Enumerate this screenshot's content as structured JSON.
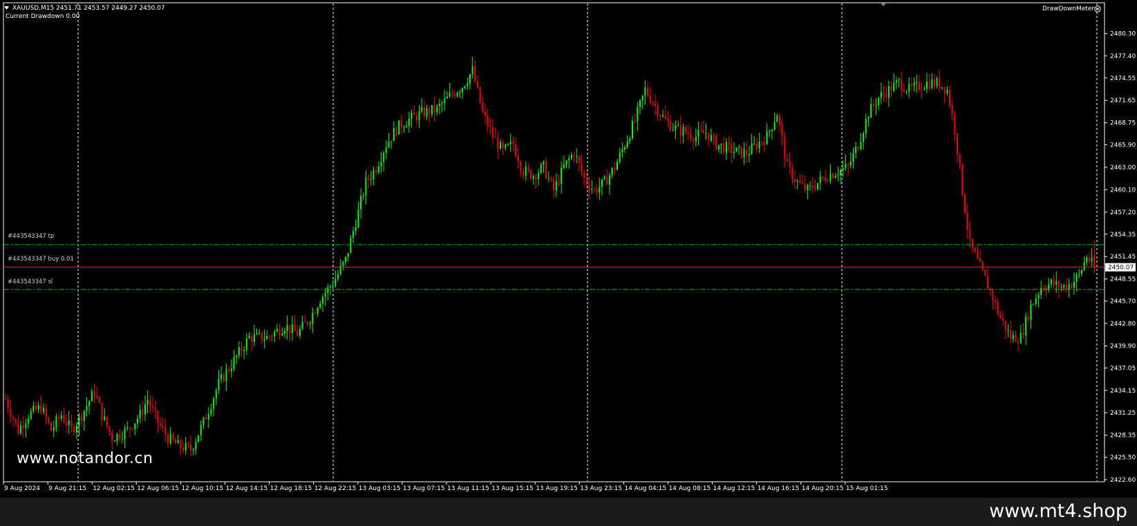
{
  "header": {
    "symbol_line": "XAUUSD,M15  2451.71 2453.57 2449.27 2450.07",
    "drawdown_line": "Current Drawdown 0.00",
    "indicator_name": "DrawDownMeter"
  },
  "orders": {
    "tp_label": "#443543347 tp",
    "buy_label": "#443543347 buy 0.01",
    "sl_label": "#443543347 sl"
  },
  "watermarks": {
    "left": "www.notandor.cn",
    "right": "www.mt4.shop"
  },
  "icons": {
    "header_dropdown": "triangle-down-icon",
    "indicator_close": "close-circle-icon",
    "scroll_marker": "triangle-down-icon"
  },
  "colors": {
    "background": "#000000",
    "bull": "#00ff00",
    "bear": "#ff0000",
    "grid": "#ffffff",
    "tp_sl_line": "#00c000",
    "price_line": "#ff2020",
    "text": "#ffffff"
  },
  "chart_data": {
    "type": "candlestick",
    "symbol": "XAUUSD",
    "timeframe": "M15",
    "ohlc_last": {
      "open": 2451.71,
      "high": 2453.57,
      "low": 2449.27,
      "close": 2450.07
    },
    "ylim": [
      2422.6,
      2481.5
    ],
    "y_ticks": [
      "2480.30",
      "2477.40",
      "2474.55",
      "2471.65",
      "2468.75",
      "2465.90",
      "2463.00",
      "2460.10",
      "2457.20",
      "2454.35",
      "2451.45",
      "2448.55",
      "2445.70",
      "2442.80",
      "2439.90",
      "2437.05",
      "2434.15",
      "2431.25",
      "2428.35",
      "2425.50",
      "2422.60"
    ],
    "current_price": "2450.07",
    "x_ticks": [
      "9 Aug 2024",
      "9 Aug 21:15",
      "12 Aug 02:15",
      "12 Aug 06:15",
      "12 Aug 10:15",
      "12 Aug 14:15",
      "12 Aug 18:15",
      "12 Aug 22:15",
      "13 Aug 03:15",
      "13 Aug 07:15",
      "13 Aug 11:15",
      "13 Aug 15:15",
      "13 Aug 19:15",
      "13 Aug 23:15",
      "14 Aug 04:15",
      "14 Aug 08:15",
      "14 Aug 12:15",
      "14 Aug 16:15",
      "14 Aug 20:15",
      "15 Aug 01:15"
    ],
    "order_levels": {
      "tp": 2453.0,
      "entry": 2450.1,
      "sl": 2447.2
    },
    "grid": "vertical-dashed",
    "price_path": [
      [
        0,
        2433
      ],
      [
        5,
        2429
      ],
      [
        9,
        2431
      ],
      [
        14,
        2432
      ],
      [
        18,
        2429
      ],
      [
        22,
        2431
      ],
      [
        26,
        2429
      ],
      [
        30,
        2431
      ],
      [
        35,
        2434
      ],
      [
        38,
        2431
      ],
      [
        42,
        2428
      ],
      [
        48,
        2429
      ],
      [
        53,
        2431
      ],
      [
        56,
        2433
      ],
      [
        60,
        2430
      ],
      [
        64,
        2428
      ],
      [
        68,
        2427
      ],
      [
        73,
        2426.5
      ],
      [
        78,
        2430
      ],
      [
        84,
        2435
      ],
      [
        90,
        2438
      ],
      [
        96,
        2441
      ],
      [
        103,
        2441
      ],
      [
        110,
        2442.5
      ],
      [
        115,
        2441.5
      ],
      [
        120,
        2443.5
      ],
      [
        124,
        2446
      ],
      [
        129,
        2448
      ],
      [
        134,
        2451
      ],
      [
        138,
        2456
      ],
      [
        142,
        2461
      ],
      [
        146,
        2463
      ],
      [
        150,
        2466
      ],
      [
        154,
        2468
      ],
      [
        158,
        2469
      ],
      [
        164,
        2470
      ],
      [
        170,
        2470.5
      ],
      [
        176,
        2472.5
      ],
      [
        180,
        2473.5
      ],
      [
        184,
        2475.5
      ],
      [
        188,
        2470
      ],
      [
        192,
        2467
      ],
      [
        196,
        2465
      ],
      [
        200,
        2466
      ],
      [
        204,
        2462.5
      ],
      [
        208,
        2462
      ],
      [
        212,
        2463
      ],
      [
        216,
        2460
      ],
      [
        220,
        2463
      ],
      [
        224,
        2465
      ],
      [
        228,
        2461.5
      ],
      [
        232,
        2460
      ],
      [
        236,
        2461
      ],
      [
        240,
        2463
      ],
      [
        244,
        2466
      ],
      [
        248,
        2469
      ],
      [
        252,
        2473
      ],
      [
        256,
        2471
      ],
      [
        260,
        2469
      ],
      [
        264,
        2468
      ],
      [
        268,
        2467.5
      ],
      [
        272,
        2467
      ],
      [
        276,
        2467.5
      ],
      [
        280,
        2466
      ],
      [
        284,
        2465.5
      ],
      [
        288,
        2465
      ],
      [
        292,
        2464.8
      ],
      [
        296,
        2466
      ],
      [
        300,
        2467
      ],
      [
        304,
        2470
      ],
      [
        308,
        2463
      ],
      [
        312,
        2461
      ],
      [
        316,
        2460
      ],
      [
        320,
        2461
      ],
      [
        324,
        2462
      ],
      [
        328,
        2462.5
      ],
      [
        332,
        2463
      ],
      [
        336,
        2466
      ],
      [
        340,
        2470
      ],
      [
        344,
        2472
      ],
      [
        348,
        2473
      ],
      [
        352,
        2474
      ],
      [
        356,
        2473
      ],
      [
        360,
        2473.5
      ],
      [
        364,
        2474
      ],
      [
        368,
        2473.8
      ],
      [
        371,
        2473
      ],
      [
        374,
        2468
      ],
      [
        377,
        2460
      ],
      [
        380,
        2453
      ],
      [
        384,
        2450
      ],
      [
        388,
        2447
      ],
      [
        392,
        2443.5
      ],
      [
        396,
        2441
      ],
      [
        400,
        2441
      ],
      [
        404,
        2445
      ],
      [
        408,
        2447.5
      ],
      [
        412,
        2448
      ],
      [
        416,
        2447.5
      ],
      [
        420,
        2448
      ],
      [
        423,
        2449
      ],
      [
        426,
        2451.5
      ],
      [
        429,
        2450.07
      ]
    ]
  }
}
